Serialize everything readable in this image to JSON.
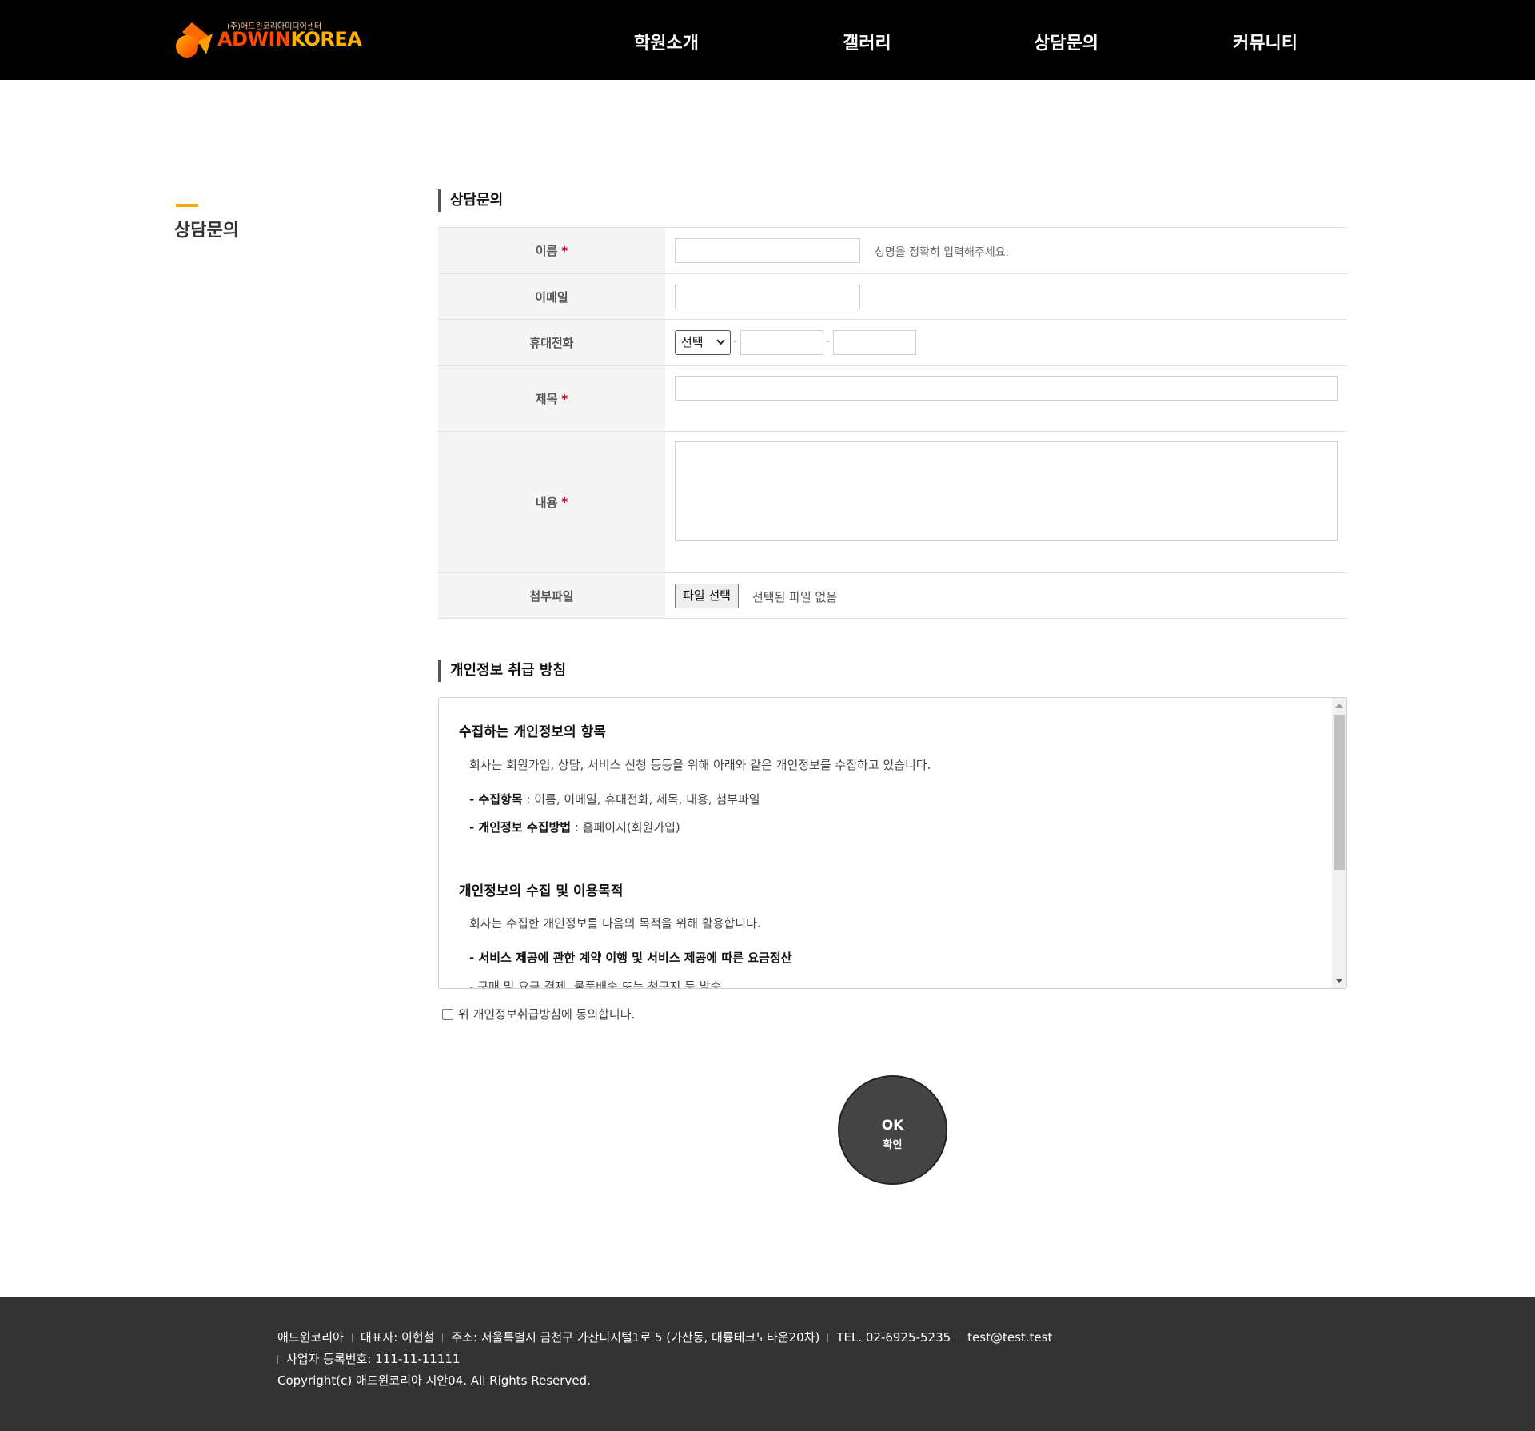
{
  "header": {
    "logo_sub": "(주)애드윈코리아미디어센터",
    "logo_part1": "ADWIN",
    "logo_part2": "KOREA",
    "nav": [
      "학원소개",
      "갤러리",
      "상담문의",
      "커뮤니티"
    ]
  },
  "side": {
    "title": "상담문의"
  },
  "form": {
    "section_title": "상담문의",
    "name": {
      "label": "이름",
      "required": "*",
      "value": "",
      "hint": "성명을 정확히 입력해주세요."
    },
    "email": {
      "label": "이메일",
      "value": ""
    },
    "phone": {
      "label": "휴대전화",
      "select_value": "선택",
      "sep": "-",
      "mid": "",
      "last": ""
    },
    "subject": {
      "label": "제목",
      "required": "*",
      "value": ""
    },
    "content": {
      "label": "내용",
      "required": "*",
      "value": ""
    },
    "file": {
      "label": "첨부파일",
      "button": "파일 선택",
      "status": "선택된 파일 없음"
    }
  },
  "privacy": {
    "section_title": "개인정보 취급 방침",
    "h1": "수집하는 개인정보의 항목",
    "p1": "회사는 회원가입, 상담, 서비스 신청 등등을 위해 아래와 같은 개인정보를 수집하고 있습니다.",
    "item1_label": "- 수집항목",
    "item1_value": " : 이름, 이메일, 휴대전화, 제목, 내용, 첨부파일",
    "item2_label": "- 개인정보 수집방법",
    "item2_value": " : 홈페이지(회원가입)",
    "h2": "개인정보의 수집 및 이용목적",
    "p2": "회사는 수집한 개인정보를 다음의 목적을 위해 활용합니다.",
    "item3": "- 서비스 제공에 관한 계약 이행 및 서비스 제공에 따른 요금정산",
    "item4_partial": "- 구매 및 요금 결제, 물품배송 또는 청구지 등 발송",
    "agree": "위 개인정보취급방침에 동의합니다."
  },
  "submit": {
    "label": "OK",
    "sub": "확인"
  },
  "footer": {
    "company": "애드윈코리아",
    "ceo": "대표자: 이현철",
    "address": "주소: 서울특별시 금천구 가산디지털1로 5 (가산동, 대륭테크노타운20차)",
    "tel": "TEL. 02-6925-5235",
    "email": "test@test.test",
    "biz": "사업자 등록번호: 111-11-11111",
    "copyright": "Copyright(c) 애드윈코리아 시안04. All Rights Reserved."
  },
  "colors": {
    "accent": "#f5a800",
    "header_bg": "#000000",
    "footer_bg": "#333333",
    "required": "#d0021b"
  }
}
